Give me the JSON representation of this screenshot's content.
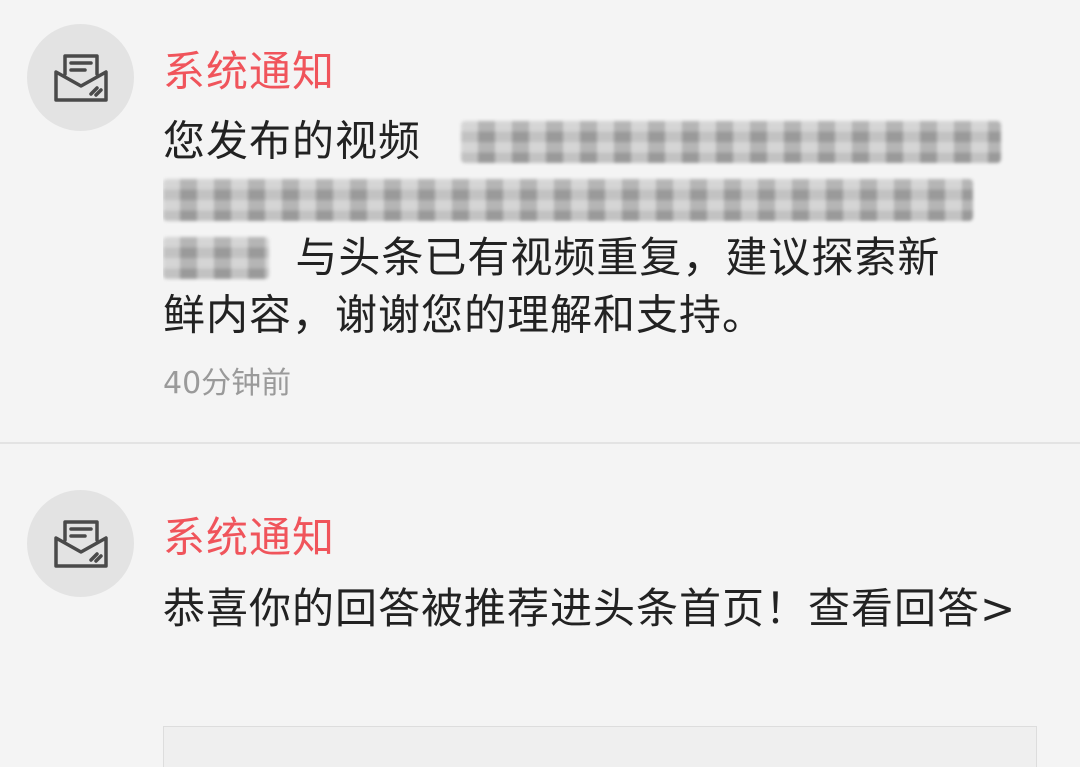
{
  "notifications": [
    {
      "sender": "系统通知",
      "message_prefix": "您发布的视频",
      "message_mid": "与头条已有视频重复，建议探索新",
      "message_end": "鲜内容，谢谢您的理解和支持。",
      "time": "40分钟前",
      "icon": "mail-envelope-icon"
    },
    {
      "sender": "系统通知",
      "message": "恭喜你的回答被推荐进头条首页！查看回答>",
      "icon": "mail-envelope-icon"
    }
  ],
  "colors": {
    "sender": "#f0545b",
    "text": "#222222",
    "time": "#9a9a9a",
    "avatar_bg": "#e3e3e3",
    "background": "#f4f4f4"
  }
}
